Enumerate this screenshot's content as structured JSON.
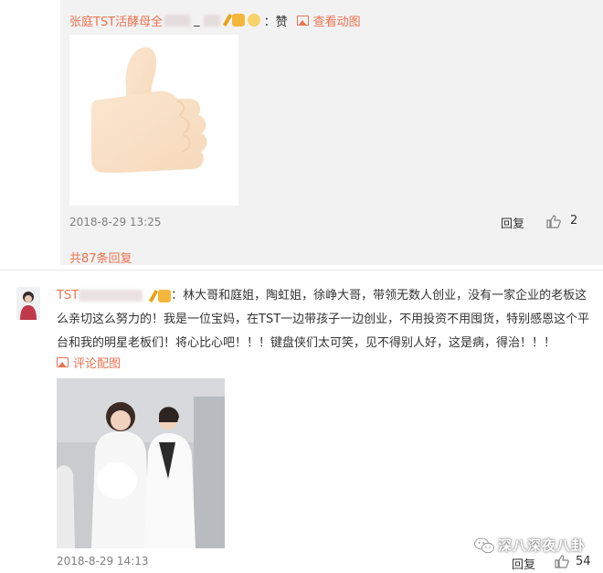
{
  "reply": {
    "username": "张庭TST活酵母全",
    "separator": "_",
    "text": "：赞",
    "image_link": "查看动图",
    "time": "2018-8-29 13:25",
    "reply_label": "回复",
    "like_count": "2",
    "total_replies": "共87条回复"
  },
  "comment": {
    "username": "TST",
    "text": "：林大哥和庭姐，陶虹姐，徐峥大哥，带领无数人创业，没有一家企业的老板这么亲切这么努力的！我是一位宝妈，在TST一边带孩子一边创业，不用投资不用囤货，特别感恩这个平台和我的明星老板们！将心比心吧！！！键盘侠们太可笑，见不得别人好，这是病，得治！！！",
    "review_link": "评论配图",
    "time": "2018-8-29 14:13",
    "reply_label": "回复",
    "like_count": "54"
  },
  "watermark": {
    "text": "深八深夜八卦",
    "icon": "wechat-icon"
  },
  "colors": {
    "accent": "#eb7350",
    "text": "#333333",
    "muted": "#808080",
    "reply_bg": "#f2f2f2"
  }
}
